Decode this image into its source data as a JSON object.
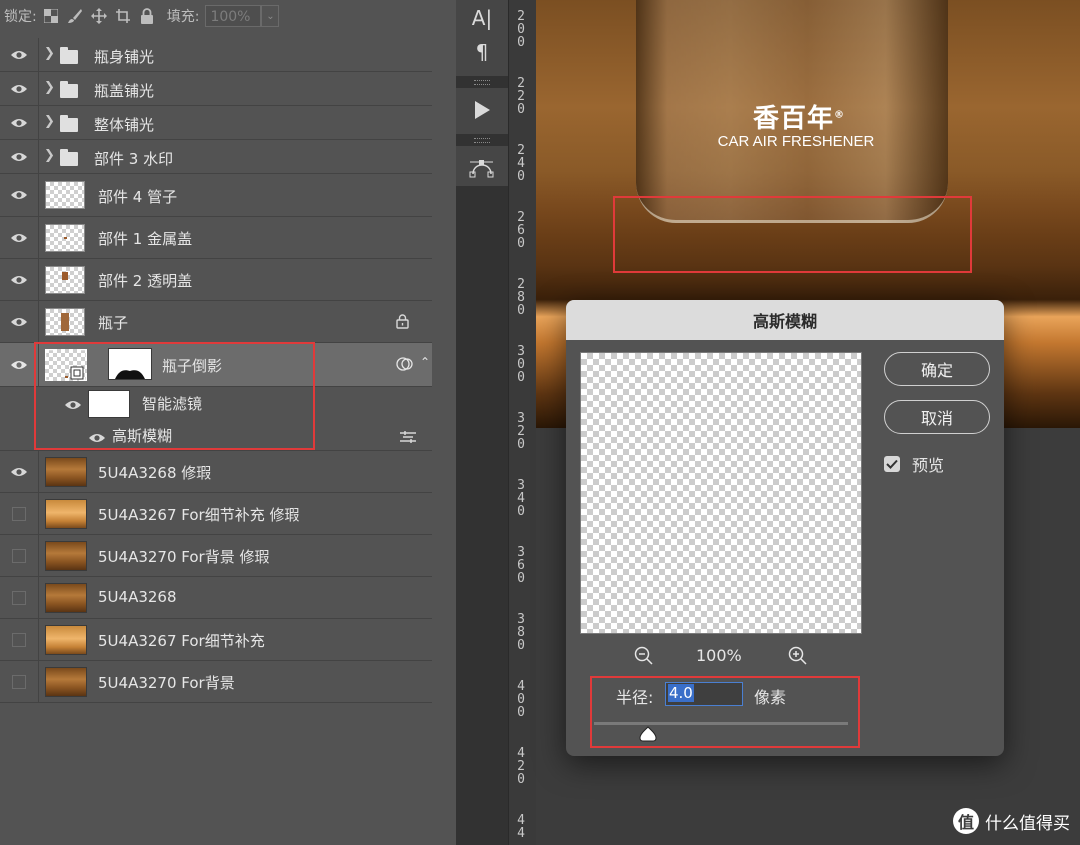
{
  "lock_bar": {
    "lock_label": "锁定:",
    "fill_label": "填充:",
    "fill_value": "100%"
  },
  "layers": [
    {
      "name": "瓶身铺光",
      "type": "group",
      "visible": true
    },
    {
      "name": "瓶盖铺光",
      "type": "group",
      "visible": true
    },
    {
      "name": "整体铺光",
      "type": "group",
      "visible": true
    },
    {
      "name": "部件 3 水印",
      "type": "group",
      "visible": true
    },
    {
      "name": "部件 4 管子",
      "type": "layer",
      "visible": true
    },
    {
      "name": "部件 1 金属盖",
      "type": "layer",
      "visible": true
    },
    {
      "name": "部件 2 透明盖",
      "type": "layer",
      "visible": true
    },
    {
      "name": "瓶子",
      "type": "layer",
      "visible": true,
      "locked": true
    },
    {
      "name": "瓶子倒影",
      "type": "smart-object",
      "visible": true,
      "selected": true
    },
    {
      "name": "智能滤镜",
      "type": "smart-filter",
      "visible": true
    },
    {
      "name": "高斯模糊",
      "type": "filter",
      "visible": true
    },
    {
      "name": "5U4A3268 修瑕",
      "type": "photo",
      "visible": true
    },
    {
      "name": "5U4A3267 For细节补充 修瑕",
      "type": "photo",
      "visible": false
    },
    {
      "name": "5U4A3270 For背景 修瑕",
      "type": "photo",
      "visible": false
    },
    {
      "name": "5U4A3268",
      "type": "photo",
      "visible": false
    },
    {
      "name": "5U4A3267 For细节补充",
      "type": "photo",
      "visible": false
    },
    {
      "name": "5U4A3270 For背景",
      "type": "photo",
      "visible": false
    }
  ],
  "ruler": {
    "labels": [
      "200",
      "220",
      "240",
      "260",
      "280",
      "300",
      "320",
      "340",
      "360",
      "380",
      "400",
      "420",
      "44"
    ]
  },
  "canvas": {
    "brand_cn": "香百年",
    "brand_mark": "®",
    "brand_en": "CAR AIR FRESHENER",
    "watermark": "什么值得买",
    "watermark_logo": "值"
  },
  "dialog": {
    "title": "高斯模糊",
    "ok_label": "确定",
    "cancel_label": "取消",
    "preview_label": "预览",
    "preview_checked": true,
    "zoom_value": "100%",
    "radius_label": "半径:",
    "radius_value": "4.0",
    "unit_label": "像素"
  },
  "colors": {
    "highlight_box": "#e03a3a",
    "panel_bg": "#535353",
    "selection": "#3a6fc9"
  }
}
